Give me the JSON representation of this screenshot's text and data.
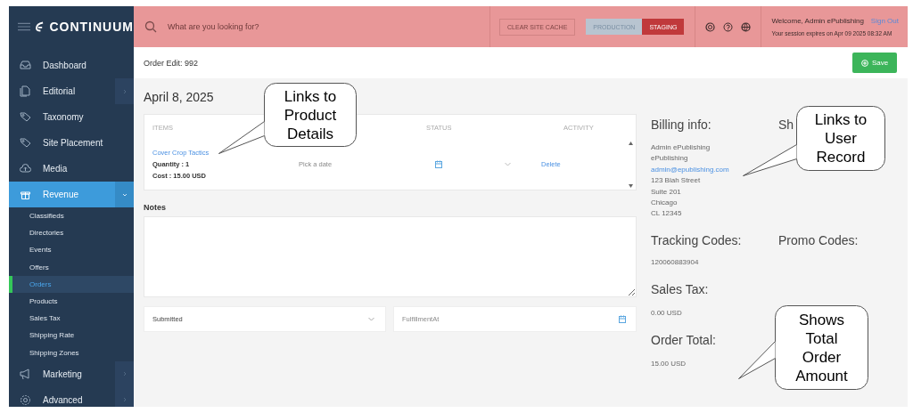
{
  "header": {
    "logo": "CONTINUUM",
    "search": {
      "placeholder": "What are you looking for?"
    },
    "clear_cache": "CLEAR SITE CACHE",
    "environments": [
      {
        "label": "PRODUCTION",
        "selected": false
      },
      {
        "label": "STAGING",
        "selected": true
      }
    ],
    "welcome": "Welcome, Admin ePublishing",
    "sign_out": "Sign Out",
    "session": "Your session expires on Apr 09 2025 08:32 AM"
  },
  "sidebar": {
    "items": [
      {
        "label": "Dashboard",
        "selected": false
      },
      {
        "label": "Editorial",
        "selected": false,
        "expanded": false
      },
      {
        "label": "Taxonomy",
        "selected": false
      },
      {
        "label": "Site Placement",
        "selected": false
      },
      {
        "label": "Media",
        "selected": false
      },
      {
        "label": "Revenue",
        "selected": true,
        "expanded": true,
        "children": [
          {
            "label": "Classifieds",
            "selected": false
          },
          {
            "label": "Directories",
            "selected": false
          },
          {
            "label": "Events",
            "selected": false
          },
          {
            "label": "Offers",
            "selected": false
          },
          {
            "label": "Orders",
            "selected": true
          },
          {
            "label": "Products",
            "selected": false
          },
          {
            "label": "Sales Tax",
            "selected": false
          },
          {
            "label": "Shipping Rate",
            "selected": false
          },
          {
            "label": "Shipping Zones",
            "selected": false
          }
        ]
      },
      {
        "label": "Marketing",
        "selected": false,
        "expanded": false
      },
      {
        "label": "Advanced",
        "selected": false,
        "expanded": false
      }
    ]
  },
  "page": {
    "title": "Order Edit: 992",
    "save": "Save",
    "date": "April 8, 2025",
    "items_table": {
      "columns": [
        "ITEMS",
        "STATUS",
        "ACTIVITY"
      ],
      "rows": [
        {
          "item": "Cover Crop Tactics",
          "quantity": "Quantity : 1",
          "cost": "Cost : 15.00 USD",
          "date_placeholder": "Pick a date",
          "action": "Delete"
        }
      ]
    },
    "notes_label": "Notes",
    "status_value": "Submitted",
    "fulfillment_placeholder": "FulfillmentAt"
  },
  "summary": {
    "billing_title": "Billing info:",
    "shipping_title": "Sh",
    "billing_lines": [
      {
        "kind": "text",
        "text": "Admin ePublishing"
      },
      {
        "kind": "text",
        "text": "ePublishing"
      },
      {
        "kind": "link",
        "text": "admin@epublishing.com"
      },
      {
        "kind": "text",
        "text": "123 Blah Street"
      },
      {
        "kind": "text",
        "text": "Suite 201"
      },
      {
        "kind": "text",
        "text": "Chicago"
      },
      {
        "kind": "text",
        "text": "CL 12345"
      }
    ],
    "tracking_title": "Tracking Codes:",
    "promo_title": "Promo Codes:",
    "tracking_value": "120060883904",
    "sales_tax_title": "Sales Tax:",
    "sales_tax_value": "0.00 USD",
    "total_title": "Order Total:",
    "total_value": "15.00 USD"
  },
  "callouts": [
    {
      "text": "Links to Product Details"
    },
    {
      "text": "Links to User Record"
    },
    {
      "text": "Shows Total Order Amount"
    }
  ]
}
